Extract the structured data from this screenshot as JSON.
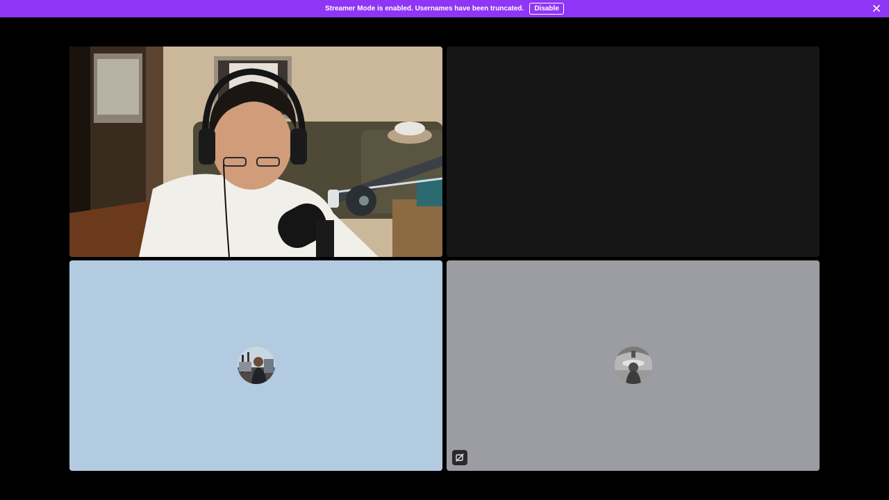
{
  "notice": {
    "text": "Streamer Mode is enabled. Usernames have been truncated.",
    "button_label": "Disable",
    "color": "#8f35f5"
  },
  "tiles": [
    {
      "kind": "video",
      "background": "#2b2218"
    },
    {
      "kind": "video-off",
      "background": "#161616"
    },
    {
      "kind": "avatar",
      "background": "#b3cbe0"
    },
    {
      "kind": "avatar",
      "background": "#9c9da3",
      "badge_icon": "video-off-icon"
    }
  ],
  "icons": {
    "close": "close-icon",
    "badge": "camera-off-icon"
  }
}
